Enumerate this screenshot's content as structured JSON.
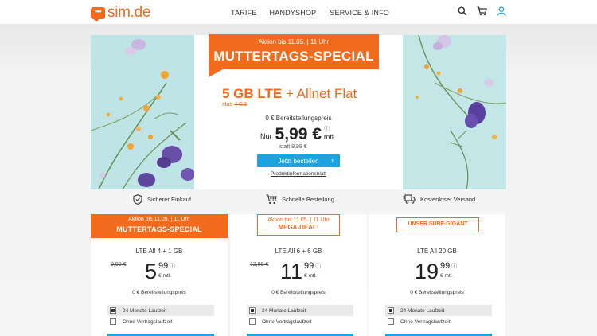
{
  "header": {
    "logo_text": "sim.de",
    "logo_dots": "•••",
    "nav": [
      "TARIFE",
      "HANDYSHOP",
      "SERVICE & INFO"
    ],
    "icons": [
      "search-icon",
      "cart-icon",
      "user-icon"
    ]
  },
  "colors": {
    "brand_orange": "#f26b1d",
    "button_blue": "#1aa3e0"
  },
  "hero": {
    "banner_sub": "Aktion bis 11.05. | 11 Uhr",
    "banner_title": "MUTTERTAGS-SPECIAL",
    "offer_bold": "5 GB LTE",
    "offer_rest": " + Allnet Flat",
    "statt_prefix": "statt ",
    "statt_value": "4 GB",
    "setup_fee": "0 € Bereitstellungspreis",
    "price_prefix": "Nur",
    "price": "5,99 €",
    "price_info": "ⓘ",
    "price_unit": "mtl.",
    "old_prefix": "statt ",
    "old_price": "9,99 €",
    "cta": "Jetzt bestellen",
    "cta_chevron": "›",
    "info_link": "Produktinformationsblatt"
  },
  "trust": [
    {
      "icon": "shield-check-icon",
      "label": "Sicherer Einkauf"
    },
    {
      "icon": "shopping-cart-icon",
      "label": "Schnelle Bestellung"
    },
    {
      "icon": "delivery-truck-icon",
      "label": "Kostenloser Versand"
    }
  ],
  "cards": [
    {
      "badge_a": "Aktion bis 11.05. | 11 Uhr",
      "badge_b": "MUTTERTAGS-SPECIAL",
      "name": "LTE All 4 + 1 GB",
      "old_price": "9,99 €",
      "price_int": "5",
      "price_dec": "99",
      "info": "ⓘ",
      "unit": "€ mtl.",
      "setup": "0 € Bereitstellungspreis",
      "options": [
        {
          "label": "24 Monate Laufzeit",
          "checked": true
        },
        {
          "label": "Ohne Vertragslaufzeit",
          "checked": false
        }
      ]
    },
    {
      "badge_a": "Aktion bis 11.05. | 11 Uhr",
      "badge_b": "MEGA-DEAL!",
      "name": "LTE All 6 + 6 GB",
      "old_price": "12,99 €",
      "price_int": "11",
      "price_dec": "99",
      "info": "ⓘ",
      "unit": "€ mtl.",
      "setup": "0 € Bereitstellungspreis",
      "options": [
        {
          "label": "24 Monate Laufzeit",
          "checked": true
        },
        {
          "label": "Ohne Vertragslaufzeit",
          "checked": false
        }
      ]
    },
    {
      "badge_b": "UNSER SURF-GIGANT",
      "name": "LTE All 20 GB",
      "price_int": "19",
      "price_dec": "99",
      "info": "ⓘ",
      "unit": "€ mtl.",
      "setup": "0 € Bereitstellungspreis",
      "options": [
        {
          "label": "24 Monate Laufzeit",
          "checked": true
        },
        {
          "label": "Ohne Vertragslaufzeit",
          "checked": false
        }
      ]
    }
  ]
}
